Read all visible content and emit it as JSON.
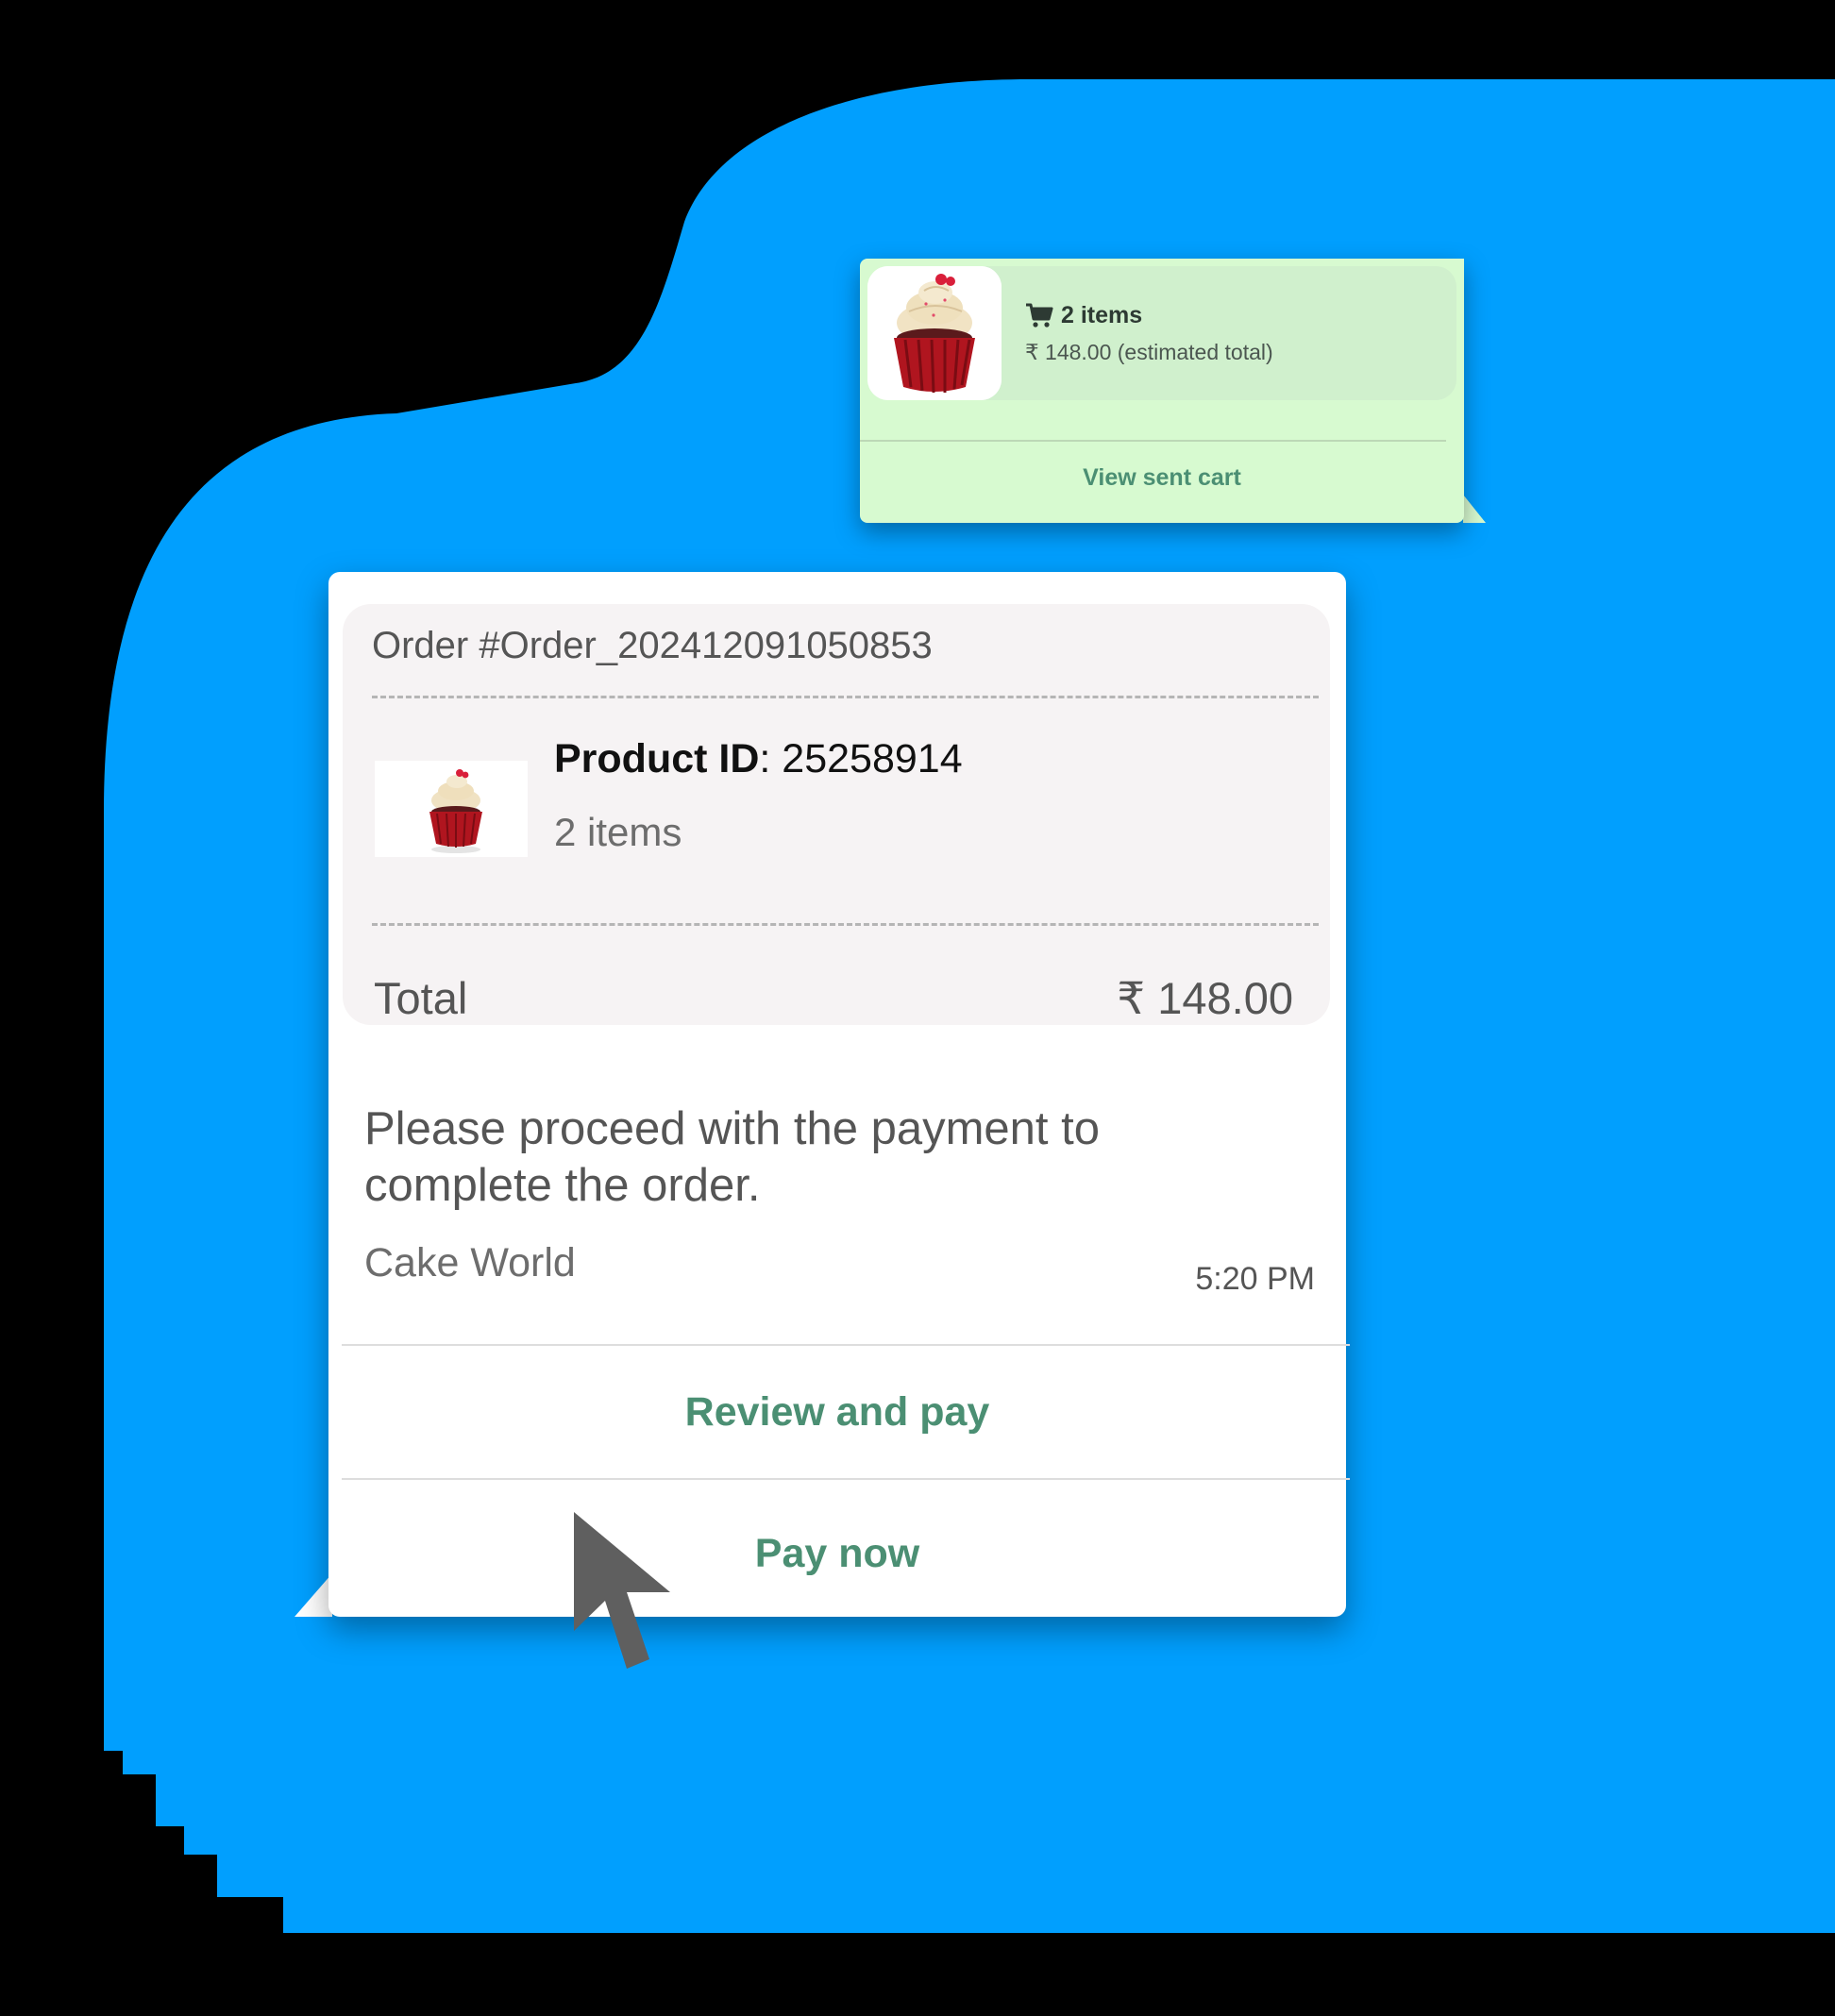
{
  "colors": {
    "backdrop": "#000000",
    "blue_shape": "#019ffe",
    "cart_bubble": "#d7fad0",
    "order_bubble": "#ffffff",
    "order_card": "#f6f3f4",
    "accent_green": "#4b8f73",
    "cursor": "#5f5f5f"
  },
  "sent_cart": {
    "cart_icon": "shopping-cart-icon",
    "item_count": "2 items",
    "estimated_total": "₹ 148.00 (estimated total)",
    "view_label": "View sent cart"
  },
  "order": {
    "number": "Order #Order_202412091050853",
    "product_id_label": "Product ID",
    "product_id_value": ": 25258914",
    "items": "2 items",
    "total_label": "Total",
    "total_value": "₹ 148.00",
    "message": "Please proceed with the payment to complete the order.",
    "sender": "Cake World",
    "time": "5:20 PM",
    "review_label": "Review and pay",
    "pay_label": "Pay now"
  },
  "cursor_icon": "mouse-pointer-icon"
}
